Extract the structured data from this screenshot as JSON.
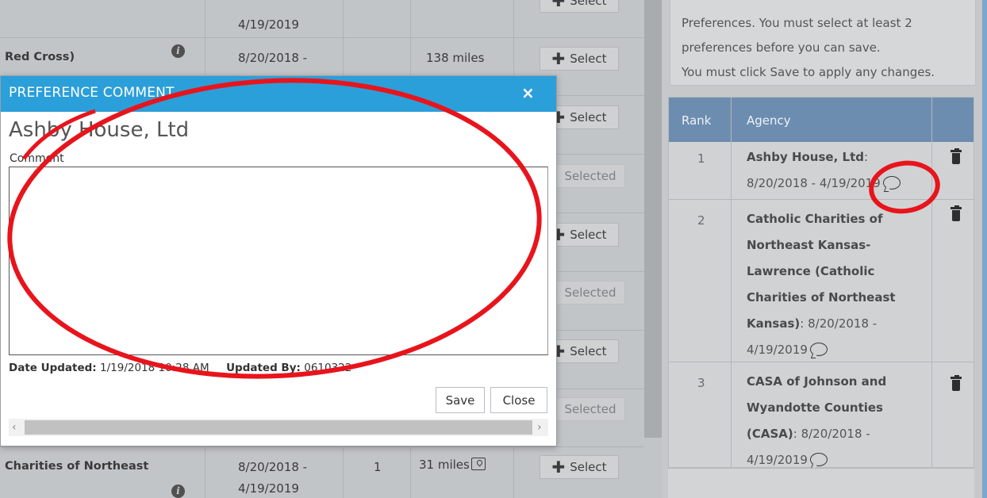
{
  "background_table": {
    "rows": [
      {
        "agency": "",
        "date1": "",
        "date2": "4/19/2019",
        "count": "",
        "distance": "",
        "action": "select",
        "info": false
      },
      {
        "agency": "Red Cross)",
        "date1": "8/20/2018 -",
        "date2": "",
        "count": "",
        "distance": "138 miles",
        "action": "select",
        "info": true
      },
      {
        "agency": "",
        "date1": "",
        "date2": "",
        "count": "",
        "distance": "",
        "action": "select",
        "info": false
      },
      {
        "agency": "",
        "date1": "",
        "date2": "",
        "count": "",
        "distance": "",
        "action": "selected",
        "info": false
      },
      {
        "agency": "",
        "date1": "",
        "date2": "",
        "count": "",
        "distance": "",
        "action": "select",
        "info": false
      },
      {
        "agency": "",
        "date1": "",
        "date2": "",
        "count": "",
        "distance": "",
        "action": "selected",
        "info": false
      },
      {
        "agency": "",
        "date1": "",
        "date2": "",
        "count": "",
        "distance": "",
        "action": "select",
        "info": false
      },
      {
        "agency": "",
        "date1": "",
        "date2": "",
        "count": "",
        "distance": "",
        "action": "selected",
        "info": false
      },
      {
        "agency": "Charities of Northeast",
        "date1": "8/20/2018 -",
        "date2": "4/19/2019",
        "count": "1",
        "distance": "31 miles",
        "action": "select",
        "info": true
      }
    ],
    "select_label": "Select",
    "selected_label": "Selected"
  },
  "right_panel": {
    "notice_lines": [
      "Preferences. You must select at least 2",
      "preferences before you can save.",
      "You must click Save to apply any changes."
    ],
    "columns": {
      "rank": "Rank",
      "agency": "Agency"
    },
    "preferences": [
      {
        "rank": "1",
        "name": "Ashby House, Ltd",
        "dates": "8/20/2018 - 4/19/2019"
      },
      {
        "rank": "2",
        "name": "Catholic Charities of Northeast Kansas-Lawrence (Catholic Charities of Northeast Kansas)",
        "dates": "8/20/2018 - 4/19/2019"
      },
      {
        "rank": "3",
        "name": "CASA of Johnson and Wyandotte Counties (CASA)",
        "dates": "8/20/2018 - 4/19/2019"
      }
    ]
  },
  "modal": {
    "title": "PREFERENCE COMMENT",
    "close_glyph": "×",
    "agency_name": "Ashby House, Ltd",
    "comment_label": "Comment",
    "comment_value": "",
    "date_updated_label": "Date Updated:",
    "date_updated_value": "1/19/2018 10:28 AM",
    "updated_by_label": "Updated By:",
    "updated_by_value": "0610322",
    "save_label": "Save",
    "close_label": "Close"
  },
  "colors": {
    "modal_header": "#2b9fd9",
    "table_header": "#6c8db0",
    "annotation_red": "#e8141c"
  },
  "icons": [
    "info-icon",
    "plus-icon",
    "map-icon",
    "close-icon",
    "comment-icon",
    "trash-icon",
    "chevron-left-icon",
    "chevron-right-icon"
  ]
}
